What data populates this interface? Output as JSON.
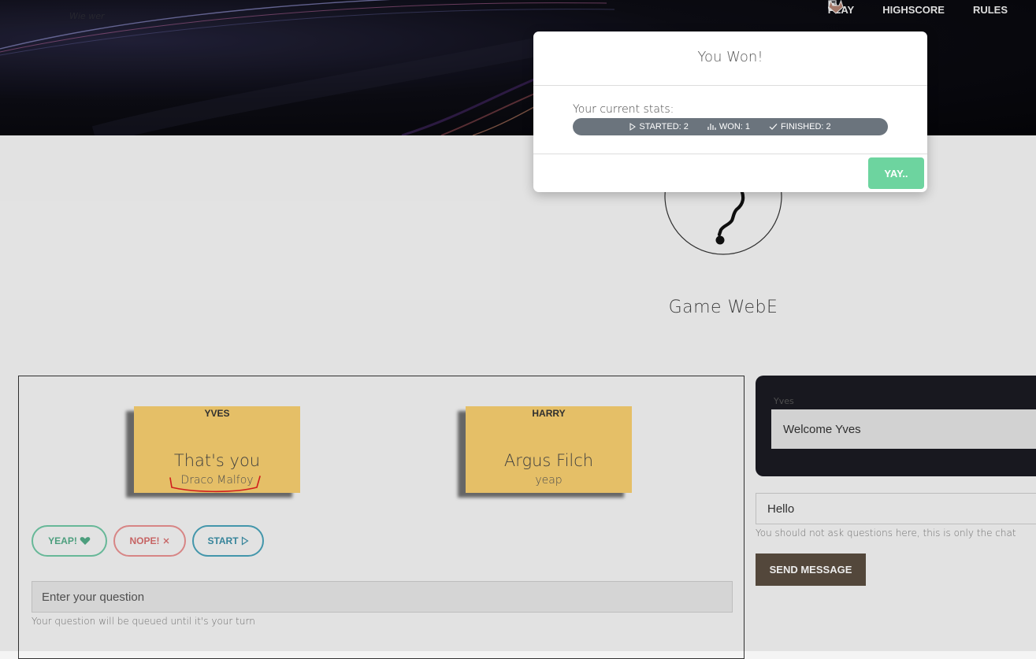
{
  "hero": {
    "faint_text": "Wie wer",
    "nav": {
      "play": "PLAY",
      "highscore": "HIGHSCORE",
      "rules": "RULES"
    }
  },
  "game": {
    "title": "Game WebE",
    "players": [
      {
        "name": "YVES",
        "main_text": "That's you",
        "sub_text": "Draco Malfoy"
      },
      {
        "name": "HARRY",
        "main_text": "Argus Filch",
        "sub_text": "yeap"
      }
    ],
    "buttons": {
      "yeap": "YEAP!",
      "nope": "NOPE!",
      "start": "START"
    },
    "question": {
      "placeholder": "Enter your question",
      "hint": "Your question will be queued until it's your turn"
    }
  },
  "chat": {
    "label": "Yves",
    "welcome_message": "Welcome Yves",
    "input_value": "Hello",
    "hint": "You should not ask questions here, this is only the chat",
    "send_label": "SEND MESSAGE"
  },
  "modal": {
    "title": "You Won!",
    "stats_label": "Your current stats:",
    "stats": {
      "started": "STARTED: 2",
      "won": "WON: 1",
      "finished": "FINISHED: 2"
    },
    "button_label": "YAY.."
  },
  "colors": {
    "note_yellow": "#f7ce6f",
    "yeap_green": "#52ab87",
    "nope_red": "#d66c6c",
    "start_teal": "#3b8ea6",
    "send_brown": "#5a4d40",
    "yay_green": "#6dd49f",
    "stats_gray": "#6b747d"
  }
}
